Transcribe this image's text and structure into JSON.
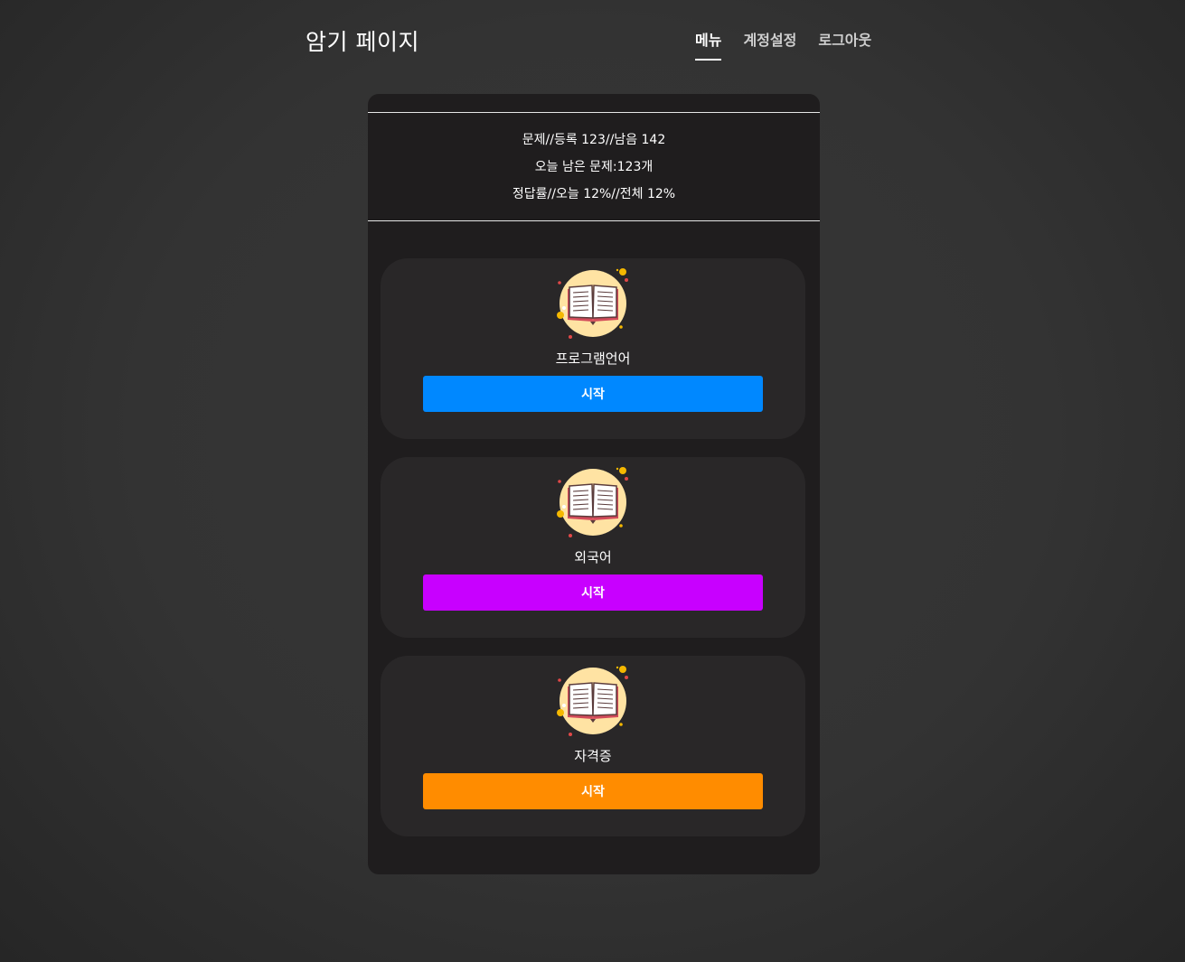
{
  "header": {
    "title": "암기 페이지",
    "nav": [
      {
        "label": "메뉴",
        "active": true
      },
      {
        "label": "계정설정",
        "active": false
      },
      {
        "label": "로그아웃",
        "active": false
      }
    ]
  },
  "stats": {
    "line1": "문제//등록 123//남음 142",
    "line2": "오늘 남은 문제:123개",
    "line3": "정답률//오늘 12%//전체 12%"
  },
  "categories": [
    {
      "label": "프로그램언어",
      "button": "시작",
      "color": "#0088ff",
      "icon": "book-icon"
    },
    {
      "label": "외국어",
      "button": "시작",
      "color": "#c800ff",
      "icon": "book-icon"
    },
    {
      "label": "자격증",
      "button": "시작",
      "color": "#ff8c00",
      "icon": "book-icon"
    }
  ]
}
